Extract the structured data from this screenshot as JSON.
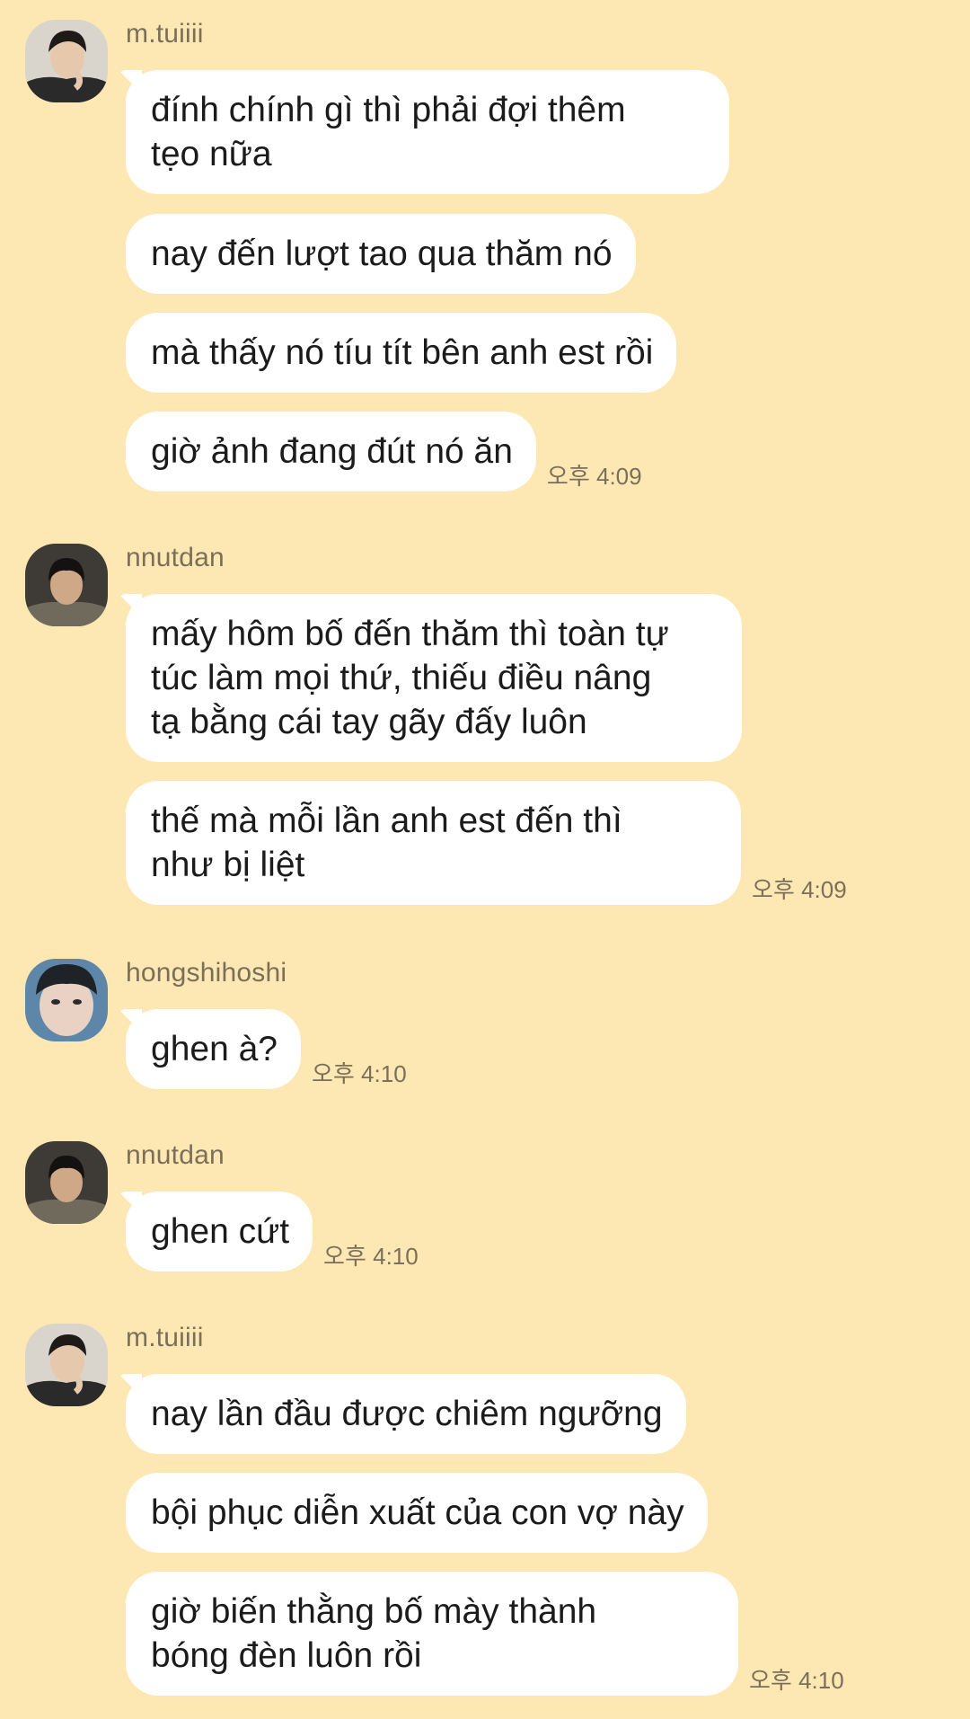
{
  "colors": {
    "background": "#fde8b3",
    "bubble": "#ffffff",
    "meta_text": "#7b6f5a"
  },
  "messages": [
    {
      "sender": "m.tuiiii",
      "avatar_icon": "avatar-m-tuiiii",
      "bubbles": [
        "đính chính gì thì phải đợi thêm\ntẹo nữa",
        "nay đến lượt tao qua thăm nó",
        "mà thấy nó tíu tít bên anh est rồi",
        "giờ ảnh đang đút nó ăn"
      ],
      "time": "오후 4:09"
    },
    {
      "sender": "nnutdan",
      "avatar_icon": "avatar-nnutdan",
      "bubbles": [
        "mấy hôm bố đến thăm thì toàn tự\ntúc làm mọi thứ, thiếu điều nâng\ntạ bằng cái tay gãy đấy luôn",
        "thế mà mỗi lần anh est đến thì\nnhư bị liệt"
      ],
      "time": "오후 4:09"
    },
    {
      "sender": "hongshihoshi",
      "avatar_icon": "avatar-hongshihoshi",
      "bubbles": [
        "ghen à?"
      ],
      "time": "오후 4:10"
    },
    {
      "sender": "nnutdan",
      "avatar_icon": "avatar-nnutdan",
      "bubbles": [
        "ghen cứt"
      ],
      "time": "오후 4:10"
    },
    {
      "sender": "m.tuiiii",
      "avatar_icon": "avatar-m-tuiiii",
      "bubbles": [
        "nay lần đầu được chiêm ngưỡng",
        "bội phục diễn xuất của con vợ này",
        "giờ biến thằng bố mày thành\nbóng đèn luôn rồi"
      ],
      "time": "오후 4:10"
    }
  ]
}
